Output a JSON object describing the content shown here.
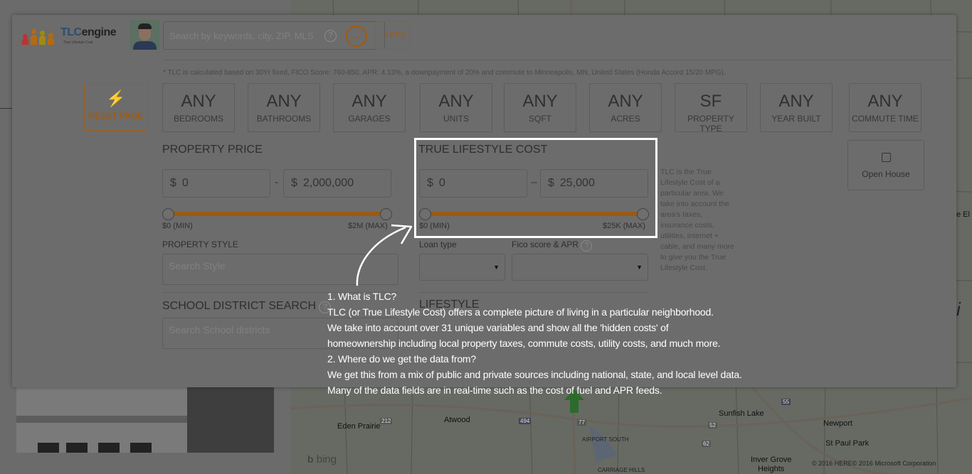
{
  "brand": {
    "name_prefix": "TLC",
    "name_suffix": "engine",
    "tagline": "True Lifestyle Cost"
  },
  "search": {
    "placeholder": "Search by keywords, city, ZIP, MLS",
    "help_glyph": "?",
    "go_glyph": "→",
    "less_label": "– LESS"
  },
  "footnote": "* TLC is calculated based on 30Yr fixed, FICO Score: 760-850, APR: 4.13%, a downpayment of 20% and commute to Minneapolis, MN, United States (Honda Accord 15/20 MPG).",
  "reset": {
    "icon": "plug-icon",
    "label": "RESET PAGE"
  },
  "filters": [
    {
      "value": "ANY",
      "label": "BEDROOMS"
    },
    {
      "value": "ANY",
      "label": "BATHROOMS"
    },
    {
      "value": "ANY",
      "label": "GARAGES"
    },
    {
      "value": "ANY",
      "label": "UNITS"
    },
    {
      "value": "ANY",
      "label": "SQFT"
    },
    {
      "value": "ANY",
      "label": "ACRES"
    },
    {
      "value": "SF",
      "label": "PROPERTY TYPE"
    },
    {
      "value": "ANY",
      "label": "YEAR BUILT"
    },
    {
      "value": "ANY",
      "label": "COMMUTE TIME"
    }
  ],
  "open_house": {
    "label": "Open House",
    "checked": false
  },
  "property_price": {
    "title": "PROPERTY PRICE",
    "currency": "$",
    "min": "0",
    "max": "2,000,000",
    "separator": "-",
    "min_label": "$0 (MIN)",
    "max_label": "$2M (MAX)",
    "range_low_fraction": 0.0,
    "range_high_fraction": 1.0
  },
  "tlc": {
    "title": "TRUE LIFESTYLE COST",
    "currency": "$",
    "min": "0",
    "max": "25,000",
    "separator": "–",
    "min_label": "$0 (MIN)",
    "max_label": "$25K (MAX)",
    "range_low_fraction": 0.0,
    "range_high_fraction": 1.0,
    "loan_type_label": "Loan type",
    "fico_label": "Fico score & APR",
    "note": "TLC is the True Lifestyle Cost of a particular area. We take into account the area's taxes, insurance costs, utilities, internet + cable, and many more to give you the True Lifestyle Cost."
  },
  "property_style": {
    "label": "PROPERTY STYLE",
    "placeholder": "Search Style"
  },
  "school": {
    "title": "SCHOOL DISTRICT SEARCH",
    "placeholder": "Search School districts"
  },
  "lifestyle": {
    "title": "LIFESTYLE"
  },
  "callout": {
    "lines": [
      "1. What is TLC?",
      "TLC (or True Lifestyle Cost) offers a complete picture of living in a particular neighborhood.",
      "We take into account over 31 unique variables and show all the 'hidden costs' of",
      "homeownership including local property taxes, commute costs, utility costs, and much more.",
      "2. Where do we get the data from?",
      "We get this from a mix of public and private sources including national, state, and local level data.",
      "Many of the data fields are in real-time such as the cost of fuel and APR feeds."
    ]
  },
  "map": {
    "labels": [
      "Eden Prairie",
      "Atwood",
      "Sunfish Lake",
      "Newport",
      "St Paul Park",
      "Inver Grove",
      "Heights",
      "AIRPORT SOUTH",
      "CARRIAGE HILLS"
    ],
    "shields": [
      "212",
      "494",
      "77",
      "62",
      "55",
      "52"
    ],
    "attribution": "bing",
    "copyright": "© 2016 HERE© 2016 Microsoft Corporation",
    "edge_text": [
      "e El",
      "i"
    ]
  },
  "colors": {
    "accent": "#a05c10",
    "overlay_text": "#ffffff"
  }
}
